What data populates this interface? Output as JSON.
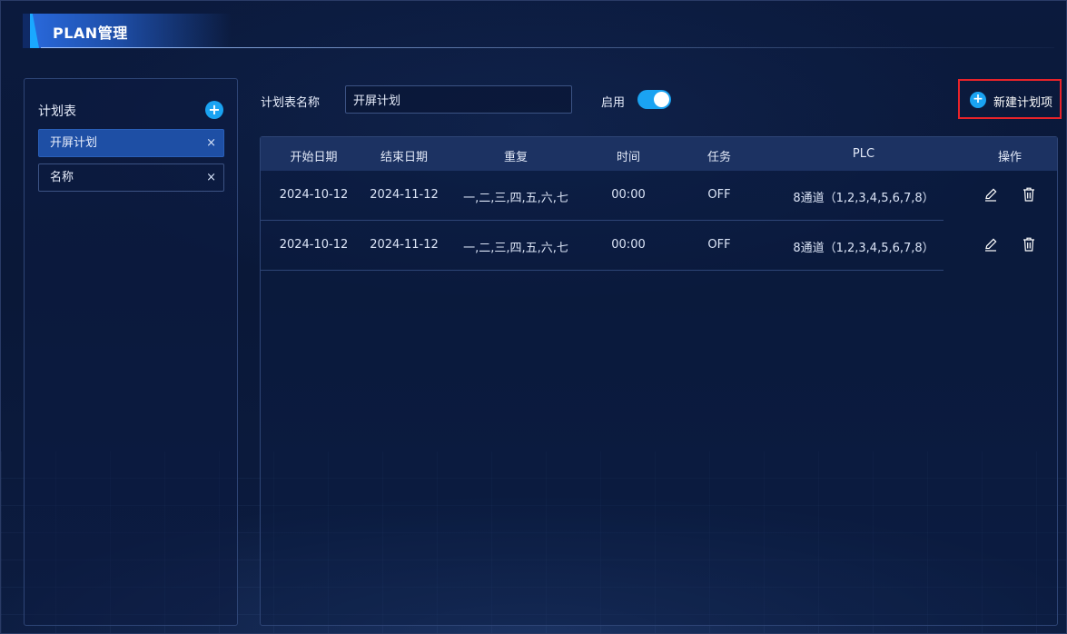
{
  "header": {
    "title": "PLAN管理"
  },
  "sidebar": {
    "title": "计划表",
    "add_symbol": "+",
    "items": [
      {
        "label": "开屏计划",
        "close": "×",
        "active": true
      },
      {
        "label": "名称",
        "close": "×",
        "active": false
      }
    ]
  },
  "toolbar": {
    "name_label": "计划表名称",
    "name_value": "开屏计划",
    "enable_label": "启用",
    "enabled": true,
    "new_item_label": "新建计划项",
    "new_item_symbol": "+"
  },
  "table": {
    "columns": [
      "开始日期",
      "结束日期",
      "重复",
      "时间",
      "任务",
      "PLC",
      "操作"
    ],
    "rows": [
      {
        "start": "2024-10-12",
        "end": "2024-11-12",
        "repeat": "一,二,三,四,五,六,七",
        "time": "00:00",
        "task": "OFF",
        "plc": "8通道（1,2,3,4,5,6,7,8）"
      },
      {
        "start": "2024-10-12",
        "end": "2024-11-12",
        "repeat": "一,二,三,四,五,六,七",
        "time": "00:00",
        "task": "OFF",
        "plc": "8通道（1,2,3,4,5,6,7,8）"
      }
    ]
  },
  "icons": {
    "edit": "pencil-icon",
    "delete": "trash-icon",
    "add": "plus-icon",
    "close": "close-icon"
  },
  "colors": {
    "accent": "#1aa3f2",
    "active_item": "#1e4fa5",
    "highlight_border": "#e8232a",
    "background": "#0a1838"
  }
}
